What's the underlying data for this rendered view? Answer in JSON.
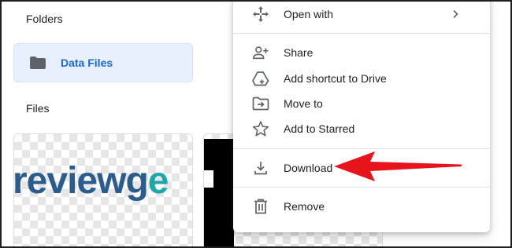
{
  "sections": {
    "folders_label": "Folders",
    "files_label": "Files"
  },
  "folders": [
    {
      "name": "Data Files",
      "icon": "folder-icon"
    }
  ],
  "files": [
    {
      "thumbnail_text_a": "reviewg",
      "thumbnail_text_b": "e"
    },
    {
      "thumbnail": "dark-image"
    }
  ],
  "menu": {
    "items": [
      {
        "label": "Open with",
        "icon": "move-arrows-icon",
        "has_submenu": true
      },
      {
        "label": "Share",
        "icon": "add-person-icon"
      },
      {
        "label": "Add shortcut to Drive",
        "icon": "drive-shortcut-icon"
      },
      {
        "label": "Move to",
        "icon": "move-to-folder-icon"
      },
      {
        "label": "Add to Starred",
        "icon": "star-icon"
      },
      {
        "label": "Download",
        "icon": "download-icon",
        "highlighted": true
      },
      {
        "label": "Remove",
        "icon": "trash-icon"
      }
    ]
  },
  "colors": {
    "folder_chip_bg": "#e8f0fe",
    "folder_text": "#1967d2",
    "logo_blue": "#2a5c8e",
    "logo_teal": "#1ea6a8",
    "annotation_arrow": "#e8141c"
  }
}
